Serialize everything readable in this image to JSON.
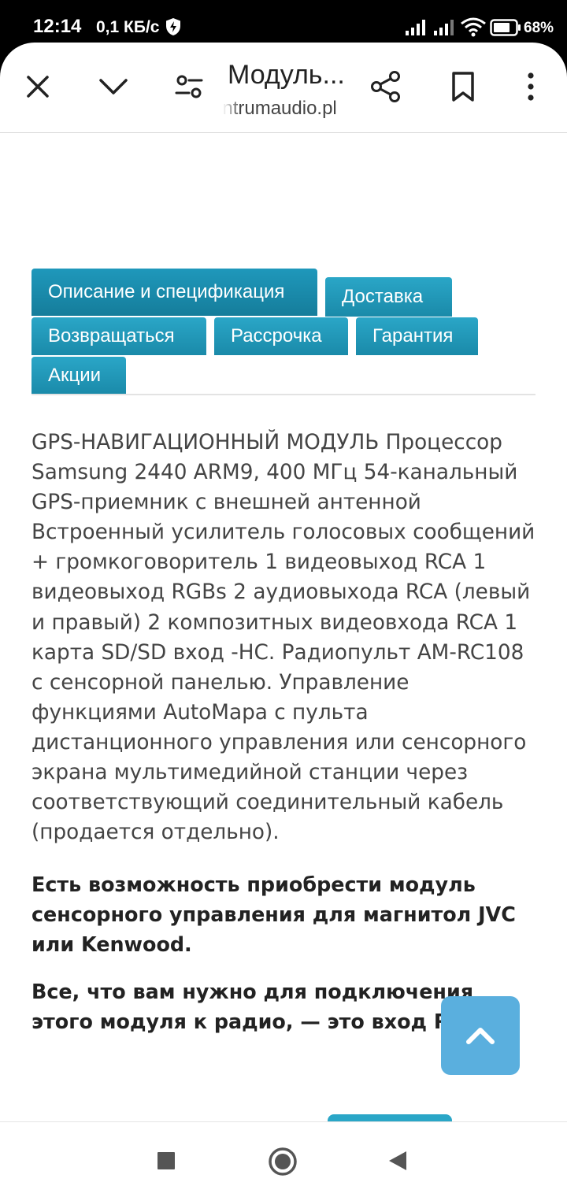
{
  "status_bar": {
    "time": "12:14",
    "network_speed": "0,1 КБ/с",
    "battery": "68%",
    "icons": [
      "shield-bolt-icon",
      "signal-icon",
      "signal-icon",
      "wifi-icon",
      "battery-icon"
    ]
  },
  "toolbar": {
    "title": "Модуль...",
    "url": "centrumaudio.pl",
    "icons": [
      "close-icon",
      "chevron-down-icon",
      "page-settings-icon",
      "share-icon",
      "bookmark-icon",
      "more-vertical-icon"
    ]
  },
  "tabs": [
    {
      "label": "Описание и спецификация",
      "active": true
    },
    {
      "label": "Доставка",
      "active": false
    },
    {
      "label": "Возвращаться",
      "active": false
    },
    {
      "label": "Рассрочка",
      "active": false
    },
    {
      "label": "Гарантия",
      "active": false
    },
    {
      "label": "Акции",
      "active": false
    }
  ],
  "description": "GPS-НАВИГАЦИОННЫЙ МОДУЛЬ Процессор Samsung 2440 ARM9, 400 МГц 54-канальный GPS-приемник с внешней антенной Встроенный усилитель голосовых сообщений + громкоговоритель 1 видеовыход RCA 1 видеовыход RGBs 2 аудиовыхода RCA (левый и правый) 2 композитных видеовхода RCA 1 карта SD/SD вход -HC. Радиопульт AM-RC108 с сенсорной панелью. Управление функциями AutoMapa с пульта дистанционного управления или сенсорного экрана мультимедийной станции через соответствующий соединительный кабель (продается отдельно).",
  "bold_paragraphs": [
    "Есть возможность приобрести модуль сенсорного управления для магнитол JVC или Kenwood.",
    "Все, что вам нужно для подключения этого модуля к радио, — это вход RGB."
  ],
  "colors": {
    "tab": "#2aa6c7",
    "tab_active": "#1f98bb",
    "scroll_top": "#5aafde",
    "text": "#444444"
  }
}
